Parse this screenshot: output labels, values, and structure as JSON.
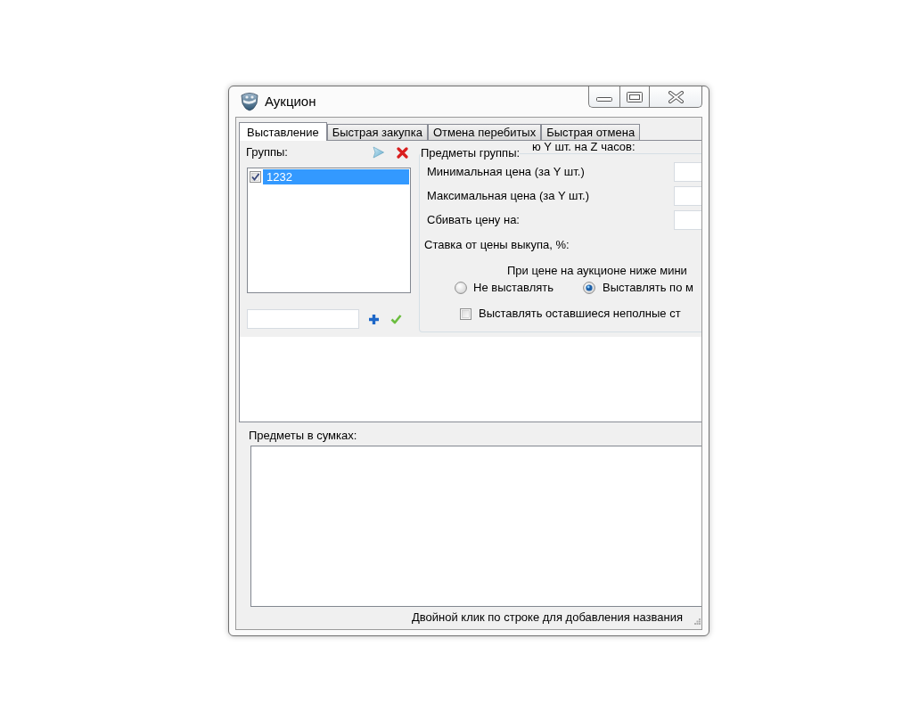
{
  "window": {
    "title": "Аукцион"
  },
  "tabs": [
    {
      "label": "Выставление",
      "selected": true
    },
    {
      "label": "Быстрая закупка",
      "selected": false
    },
    {
      "label": "Отмена перебитых",
      "selected": false
    },
    {
      "label": "Быстрая отмена",
      "selected": false
    }
  ],
  "groups": {
    "label": "Группы:",
    "items": [
      {
        "label": "1232",
        "checked": true,
        "selected": true
      }
    ]
  },
  "group_items": {
    "title": "Предметы группы:",
    "label_behind_title": "ю Y шт. на Z часов:",
    "price_fields": [
      {
        "label": "Минимальная цена (за Y шт.)"
      },
      {
        "label": "Максимальная цена (за Y шт.)"
      },
      {
        "label": "Сбивать цену на:"
      }
    ],
    "bid_label": "Ставка от цены выкупа, %:",
    "below_min": {
      "label": "При цене на аукционе ниже мини",
      "options": [
        {
          "label": "Не выставлять",
          "selected": false
        },
        {
          "label": "Выставлять по м",
          "selected": true
        }
      ]
    },
    "partial_stacks": {
      "label": "Выставлять оставшиеся неполные ст",
      "checked": false
    }
  },
  "bag_items": {
    "label": "Предметы в сумках:"
  },
  "status_bar": {
    "text": "Двойной клик по строке для добавления названия"
  }
}
